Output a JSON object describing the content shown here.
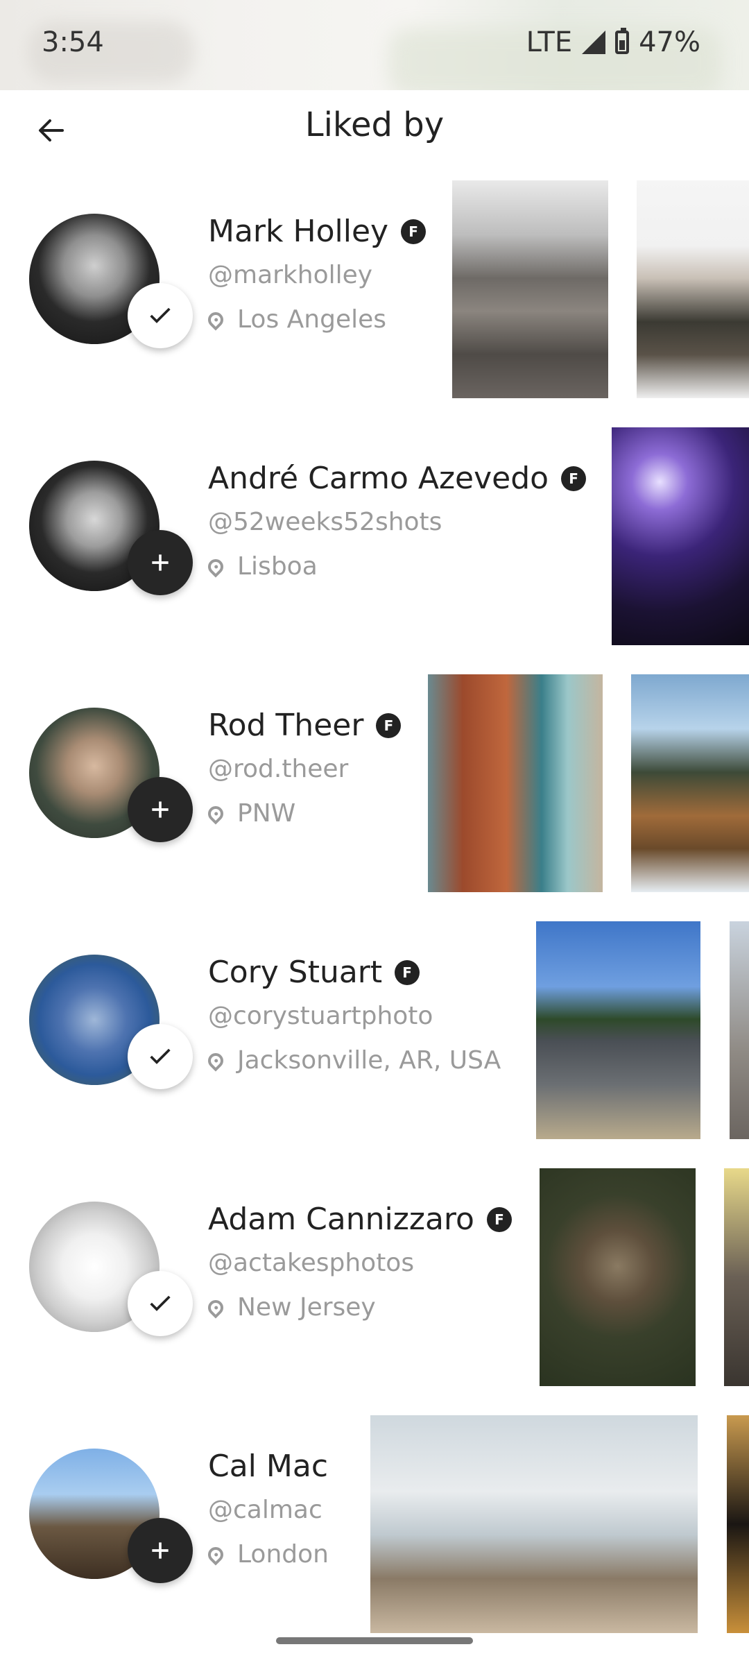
{
  "status_bar": {
    "time": "3:54",
    "network": "LTE",
    "battery": "47%"
  },
  "header": {
    "title": "Liked by"
  },
  "users": [
    {
      "name": "Mark Holley",
      "handle": "@markholley",
      "location": "Los Angeles",
      "following": true,
      "badge": "F"
    },
    {
      "name": "André Carmo Azevedo",
      "handle": "@52weeks52shots",
      "location": "Lisboa",
      "following": false,
      "badge": "F"
    },
    {
      "name": "Rod Theer",
      "handle": "@rod.theer",
      "location": "PNW",
      "following": false,
      "badge": "F"
    },
    {
      "name": "Cory Stuart",
      "handle": "@corystuartphoto",
      "location": "Jacksonville, AR, USA",
      "following": true,
      "badge": "F"
    },
    {
      "name": "Adam Cannizzaro",
      "handle": "@actakesphotos",
      "location": "New Jersey",
      "following": true,
      "badge": "F"
    },
    {
      "name": "Cal Mac",
      "handle": "@calmac",
      "location": "London",
      "following": false
    }
  ],
  "icons": {
    "back": "arrow-left-icon",
    "check": "checkmark-icon",
    "plus": "plus-icon",
    "location": "location-pin-icon",
    "badge": "featured-badge-icon"
  }
}
